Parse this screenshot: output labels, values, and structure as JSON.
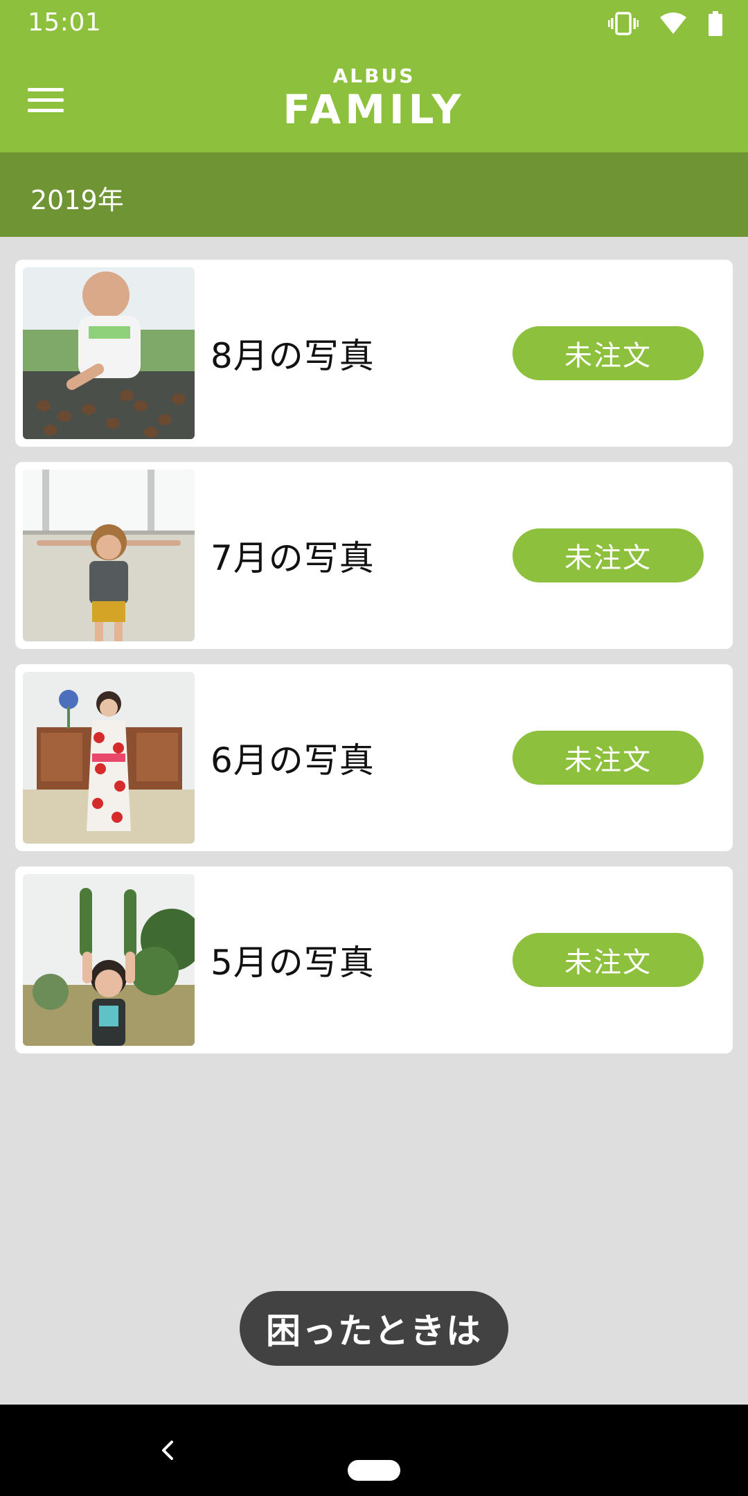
{
  "status_bar": {
    "time": "15:01",
    "icons": [
      "vibrate-icon",
      "wifi-icon",
      "battery-icon"
    ]
  },
  "app_bar": {
    "menu_icon": "hamburger-menu-icon",
    "logo_top": "ALBUS",
    "logo_bottom": "FAMILY"
  },
  "year": "2019年",
  "albums": [
    {
      "title": "8月の写真",
      "status": "未注文"
    },
    {
      "title": "7月の写真",
      "status": "未注文"
    },
    {
      "title": "6月の写真",
      "status": "未注文"
    },
    {
      "title": "5月の写真",
      "status": "未注文"
    }
  ],
  "help_button": "困ったときは",
  "colors": {
    "primary": "#8dc13d",
    "year_bar": "#6e9434",
    "background": "#dedede",
    "help_button": "#424242"
  }
}
